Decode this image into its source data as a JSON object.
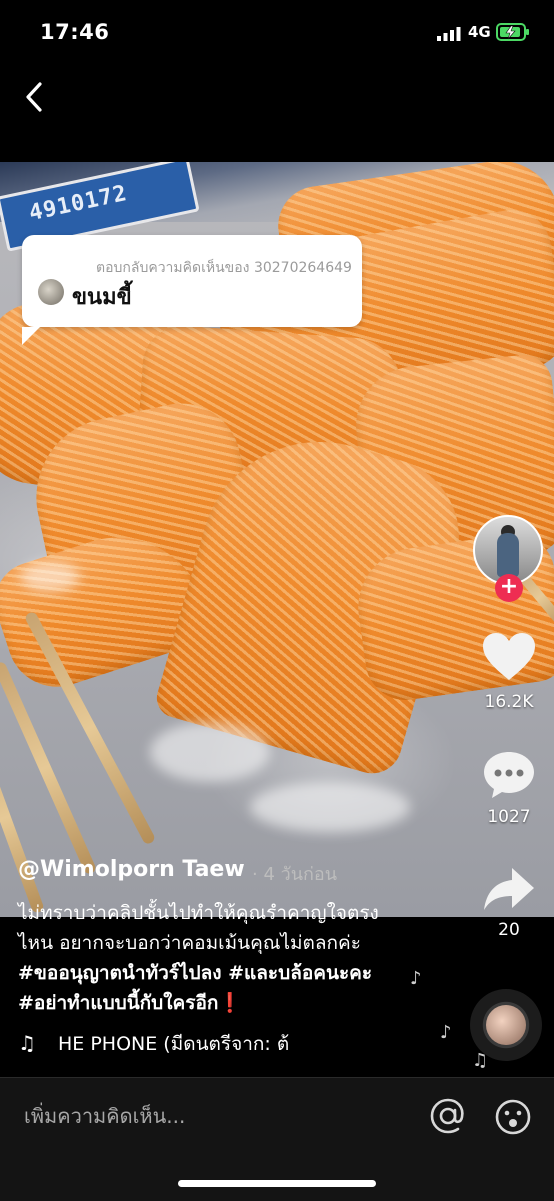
{
  "status_bar": {
    "time": "17:46",
    "network": "4G"
  },
  "reply_bubble": {
    "header": "ตอบกลับความคิดเห็นของ 30270264649",
    "text": "ขนมขี้"
  },
  "video": {
    "plate_text": "4910172"
  },
  "actions": {
    "likes": "16.2K",
    "comments": "1027",
    "shares": "20"
  },
  "post": {
    "username": "@Wimolporn Taew",
    "time_ago": "· 4 วันก่อน",
    "caption_lines": [
      "ไม่ทราบว่าคลิปชั้นไปทำให้คุณรำคาญใจตรง",
      "ไหน  อยากจะบอกว่าคอมเม้นคุณไม่ตลกค่ะ",
      "#ขออนุญาตนำทัวร์ไปลง #และบล้อคนะคะ",
      "#อย่าทำแบบนี้กับใครอีก❗️"
    ],
    "music": "HE PHONE (มีดนตรีจาก: ต้"
  },
  "comment_bar": {
    "placeholder": "เพิ่มความคิดเห็น..."
  },
  "colors": {
    "follow": "#ee2d52",
    "battery_fill": "#4cd964"
  }
}
